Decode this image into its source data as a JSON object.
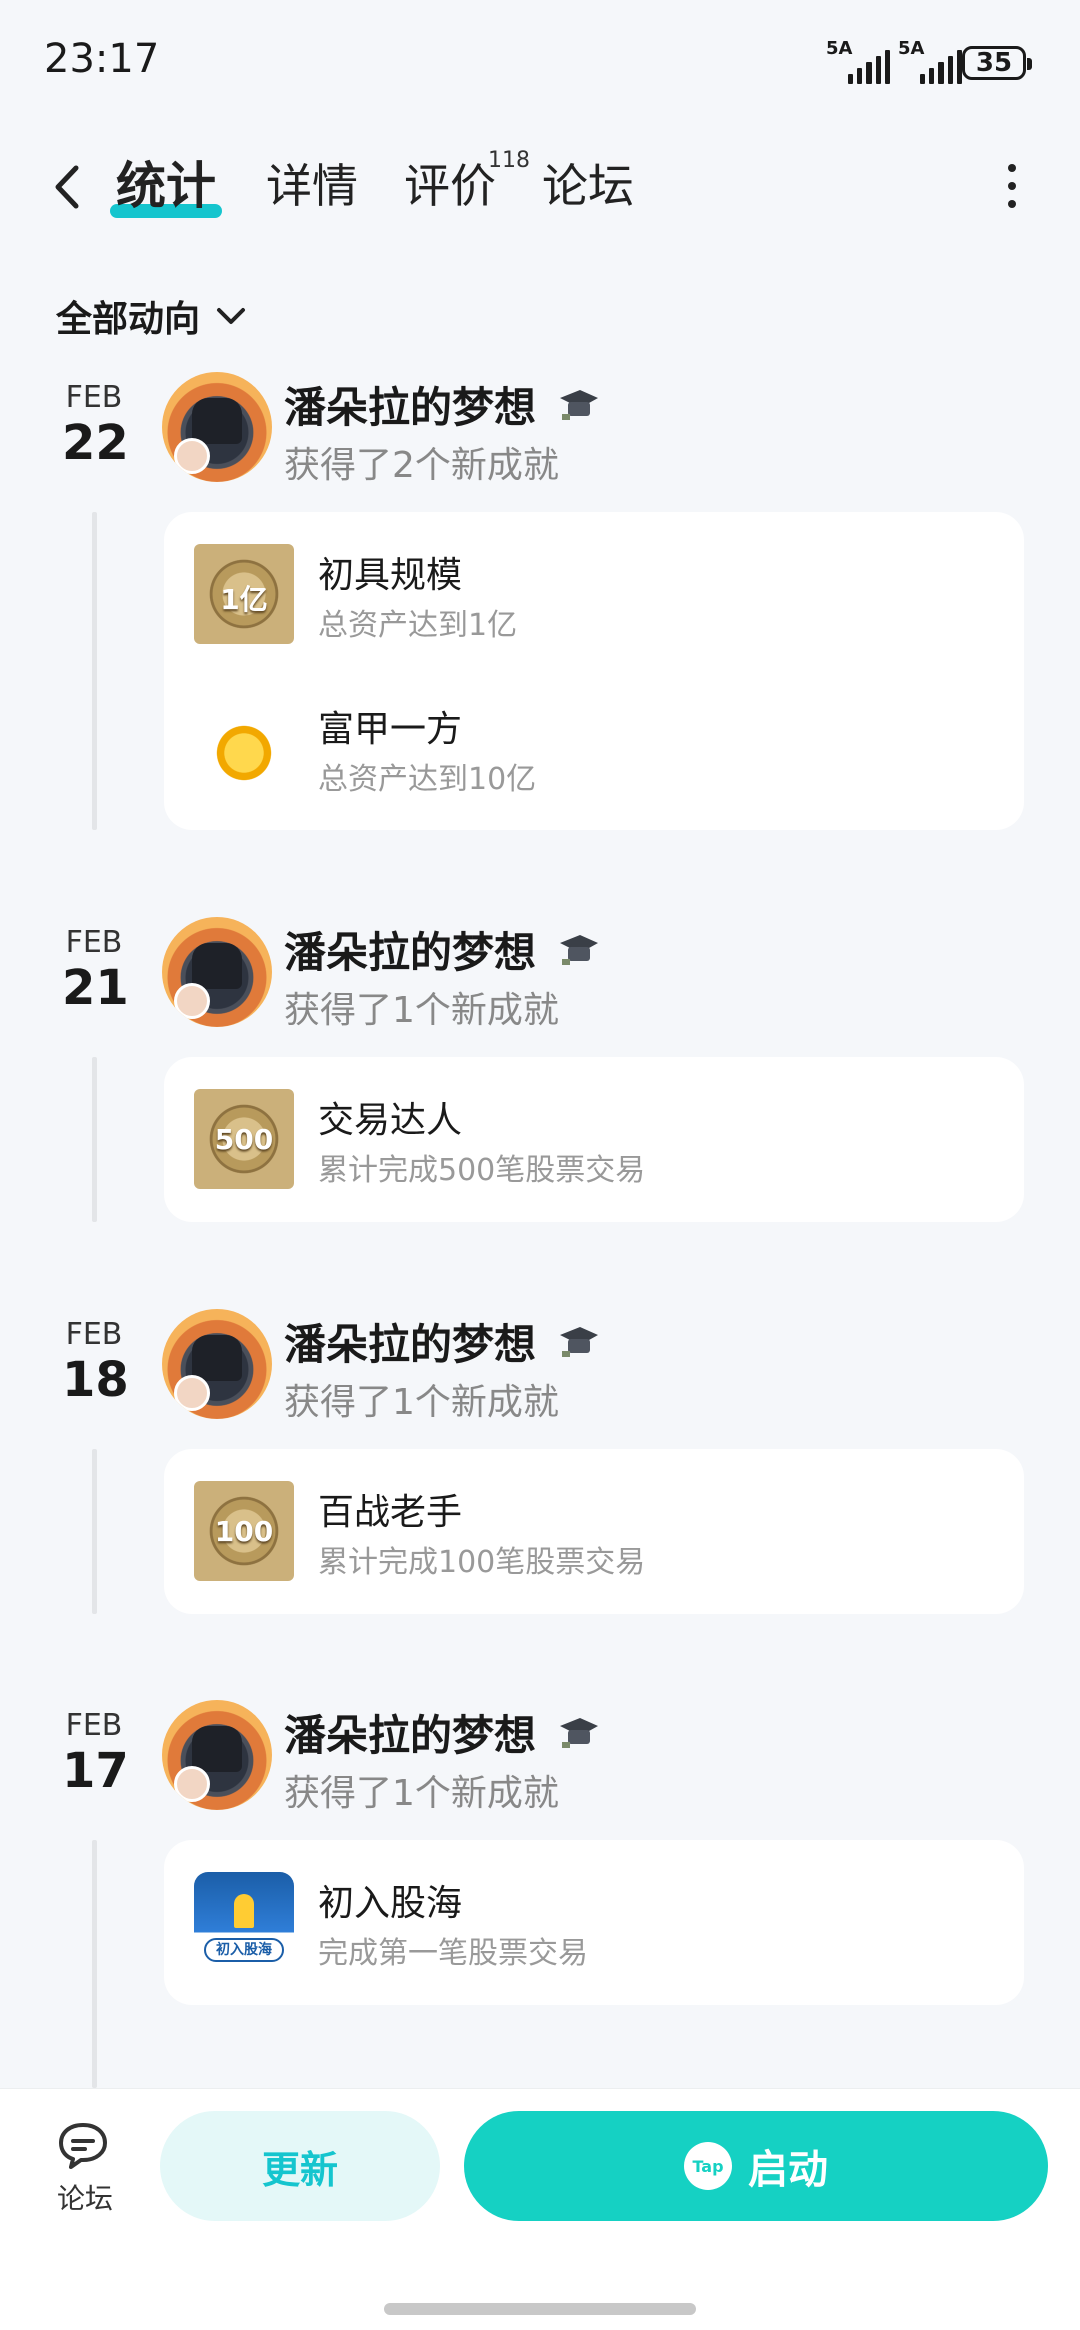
{
  "status": {
    "time": "23:17",
    "signal1": "5A",
    "signal2": "5A",
    "battery": "35"
  },
  "nav": {
    "tabs": [
      "统计",
      "详情",
      "评价",
      "论坛"
    ],
    "review_count": "118"
  },
  "filter": {
    "label": "全部动向"
  },
  "feed": [
    {
      "month": "FEB",
      "day": "22",
      "user": "潘朵拉的梦想",
      "action": "获得了2个新成就",
      "achievements": [
        {
          "name": "初具规模",
          "desc": "总资产达到1亿",
          "icon_text": "1亿"
        },
        {
          "name": "富甲一方",
          "desc": "总资产达到10亿",
          "icon_text": ""
        }
      ]
    },
    {
      "month": "FEB",
      "day": "21",
      "user": "潘朵拉的梦想",
      "action": "获得了1个新成就",
      "achievements": [
        {
          "name": "交易达人",
          "desc": "累计完成500笔股票交易",
          "icon_text": "500"
        }
      ]
    },
    {
      "month": "FEB",
      "day": "18",
      "user": "潘朵拉的梦想",
      "action": "获得了1个新成就",
      "achievements": [
        {
          "name": "百战老手",
          "desc": "累计完成100笔股票交易",
          "icon_text": "100"
        }
      ]
    },
    {
      "month": "FEB",
      "day": "17",
      "user": "潘朵拉的梦想",
      "action": "获得了1个新成就",
      "achievements": [
        {
          "name": "初入股海",
          "desc": "完成第一笔股票交易",
          "icon_text": "初入股海"
        }
      ]
    }
  ],
  "bottom": {
    "forum_label": "论坛",
    "update_label": "更新",
    "launch_label": "启动",
    "tap_logo": "Tap"
  },
  "colors": {
    "accent": "#15c5ce",
    "launch": "#15d1c3",
    "background": "#f5f7fa"
  }
}
